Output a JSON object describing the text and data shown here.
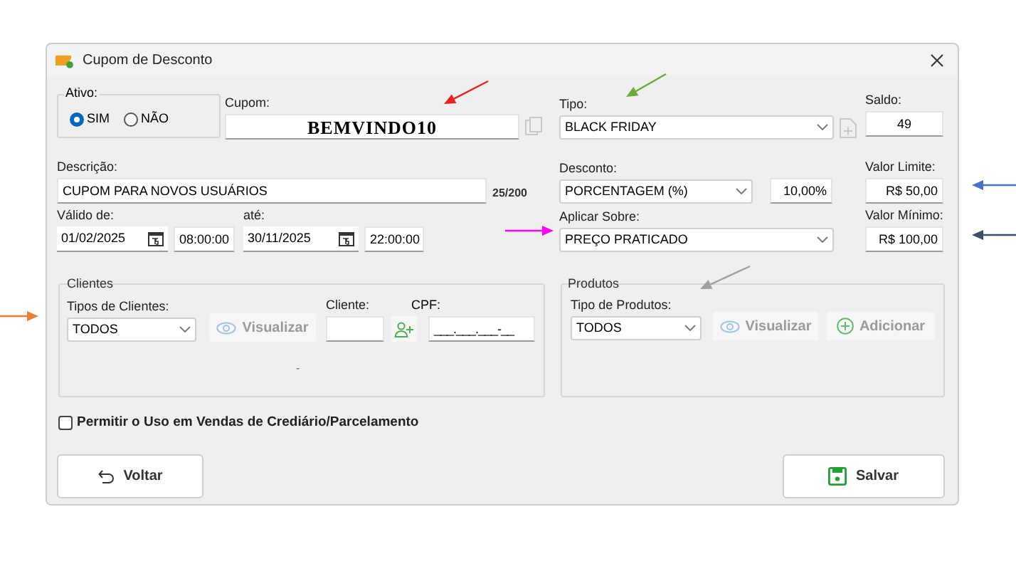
{
  "window": {
    "title": "Cupom de Desconto"
  },
  "ativo": {
    "label": "Ativo:",
    "options": [
      {
        "label": "SIM",
        "selected": true
      },
      {
        "label": "NÃO",
        "selected": false
      }
    ]
  },
  "cupom": {
    "label": "Cupom:",
    "value": "BEMVINDO10"
  },
  "tipo": {
    "label": "Tipo:",
    "value": "BLACK FRIDAY"
  },
  "saldo": {
    "label": "Saldo:",
    "value": "49"
  },
  "descricao": {
    "label": "Descrição:",
    "value": "CUPOM PARA NOVOS USUÁRIOS",
    "counter": "25/200"
  },
  "desconto": {
    "label": "Desconto:",
    "value": "PORCENTAGEM (%)",
    "amount": "10,00%"
  },
  "valor_limite": {
    "label": "Valor Limite:",
    "value": "R$ 50,00"
  },
  "validade": {
    "from_label": "Válido de:",
    "from_date": "01/02/2025",
    "from_time": "08:00:00",
    "to_label": "até:",
    "to_date": "30/11/2025",
    "to_time": "22:00:00"
  },
  "aplicar_sobre": {
    "label": "Aplicar Sobre:",
    "value": "PREÇO PRATICADO"
  },
  "valor_minimo": {
    "label": "Valor Mínimo:",
    "value": "R$ 100,00"
  },
  "clientes": {
    "title": "Clientes",
    "tipo_label": "Tipos de Clientes:",
    "tipo_value": "TODOS",
    "view_button": {
      "label": "Visualizar",
      "disabled": true
    },
    "cliente_label": "Cliente:",
    "cpf_label": "CPF:",
    "cpf_value": "___.___.___-__",
    "note": "-"
  },
  "produtos": {
    "title": "Produtos",
    "tipo_label": "Tipo de Produtos:",
    "tipo_value": "TODOS",
    "view_button": {
      "label": "Visualizar",
      "disabled": true
    },
    "add_button": {
      "label": "Adicionar",
      "disabled": true
    }
  },
  "crediario": {
    "label": "Permitir o Uso em Vendas de Crediário/Parcelamento",
    "checked": false
  },
  "buttons": [
    {
      "label": "Voltar",
      "kind": "back"
    },
    {
      "label": "Salvar",
      "kind": "save"
    }
  ],
  "annotations": [
    {
      "color": "#e8231f"
    },
    {
      "color": "#6aaa3a"
    },
    {
      "color": "#4a72c4"
    },
    {
      "color": "#3b4f6b"
    },
    {
      "color": "#ff00ff"
    },
    {
      "color": "#ed7d31"
    },
    {
      "color": "#a0a0a0"
    }
  ]
}
